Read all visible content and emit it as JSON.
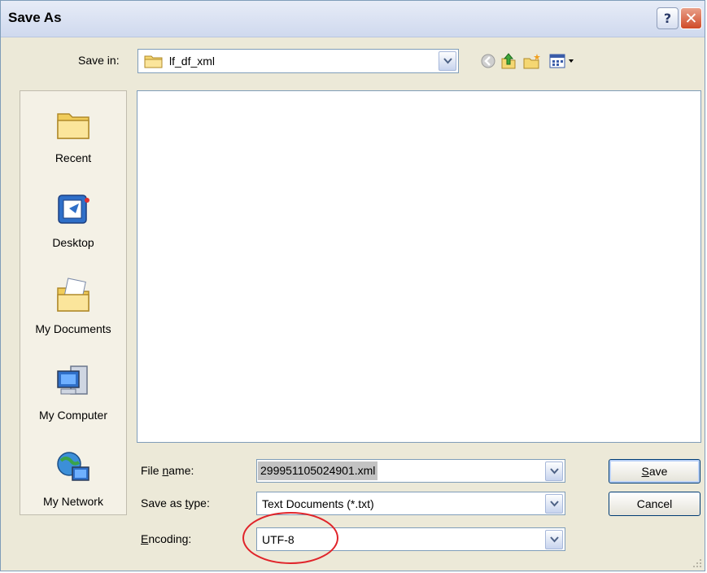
{
  "window": {
    "title": "Save As",
    "help_label": "?"
  },
  "save_in": {
    "label": "Save in:",
    "value": "lf_df_xml"
  },
  "places": [
    {
      "label": "Recent",
      "icon": "recent-folder-icon"
    },
    {
      "label": "Desktop",
      "icon": "desktop-icon"
    },
    {
      "label": "My Documents",
      "icon": "my-documents-icon"
    },
    {
      "label": "My Computer",
      "icon": "my-computer-icon"
    },
    {
      "label": "My Network",
      "icon": "my-network-icon"
    }
  ],
  "form": {
    "file_name_label_pre": "File ",
    "file_name_label_key": "n",
    "file_name_label_post": "ame:",
    "file_name_value": "299951105024901.xml",
    "save_type_label_pre": "Save as ",
    "save_type_label_key": "t",
    "save_type_label_post": "ype:",
    "save_type_value": "Text Documents (*.txt)",
    "encoding_label_key": "E",
    "encoding_label_post": "ncoding:",
    "encoding_value": "UTF-8"
  },
  "buttons": {
    "save_key": "S",
    "save_rest": "ave",
    "cancel": "Cancel"
  },
  "colors": {
    "highlight_ellipse": "#e0242a",
    "dialog_bg": "#ece9d8",
    "field_border": "#7f9db9"
  }
}
